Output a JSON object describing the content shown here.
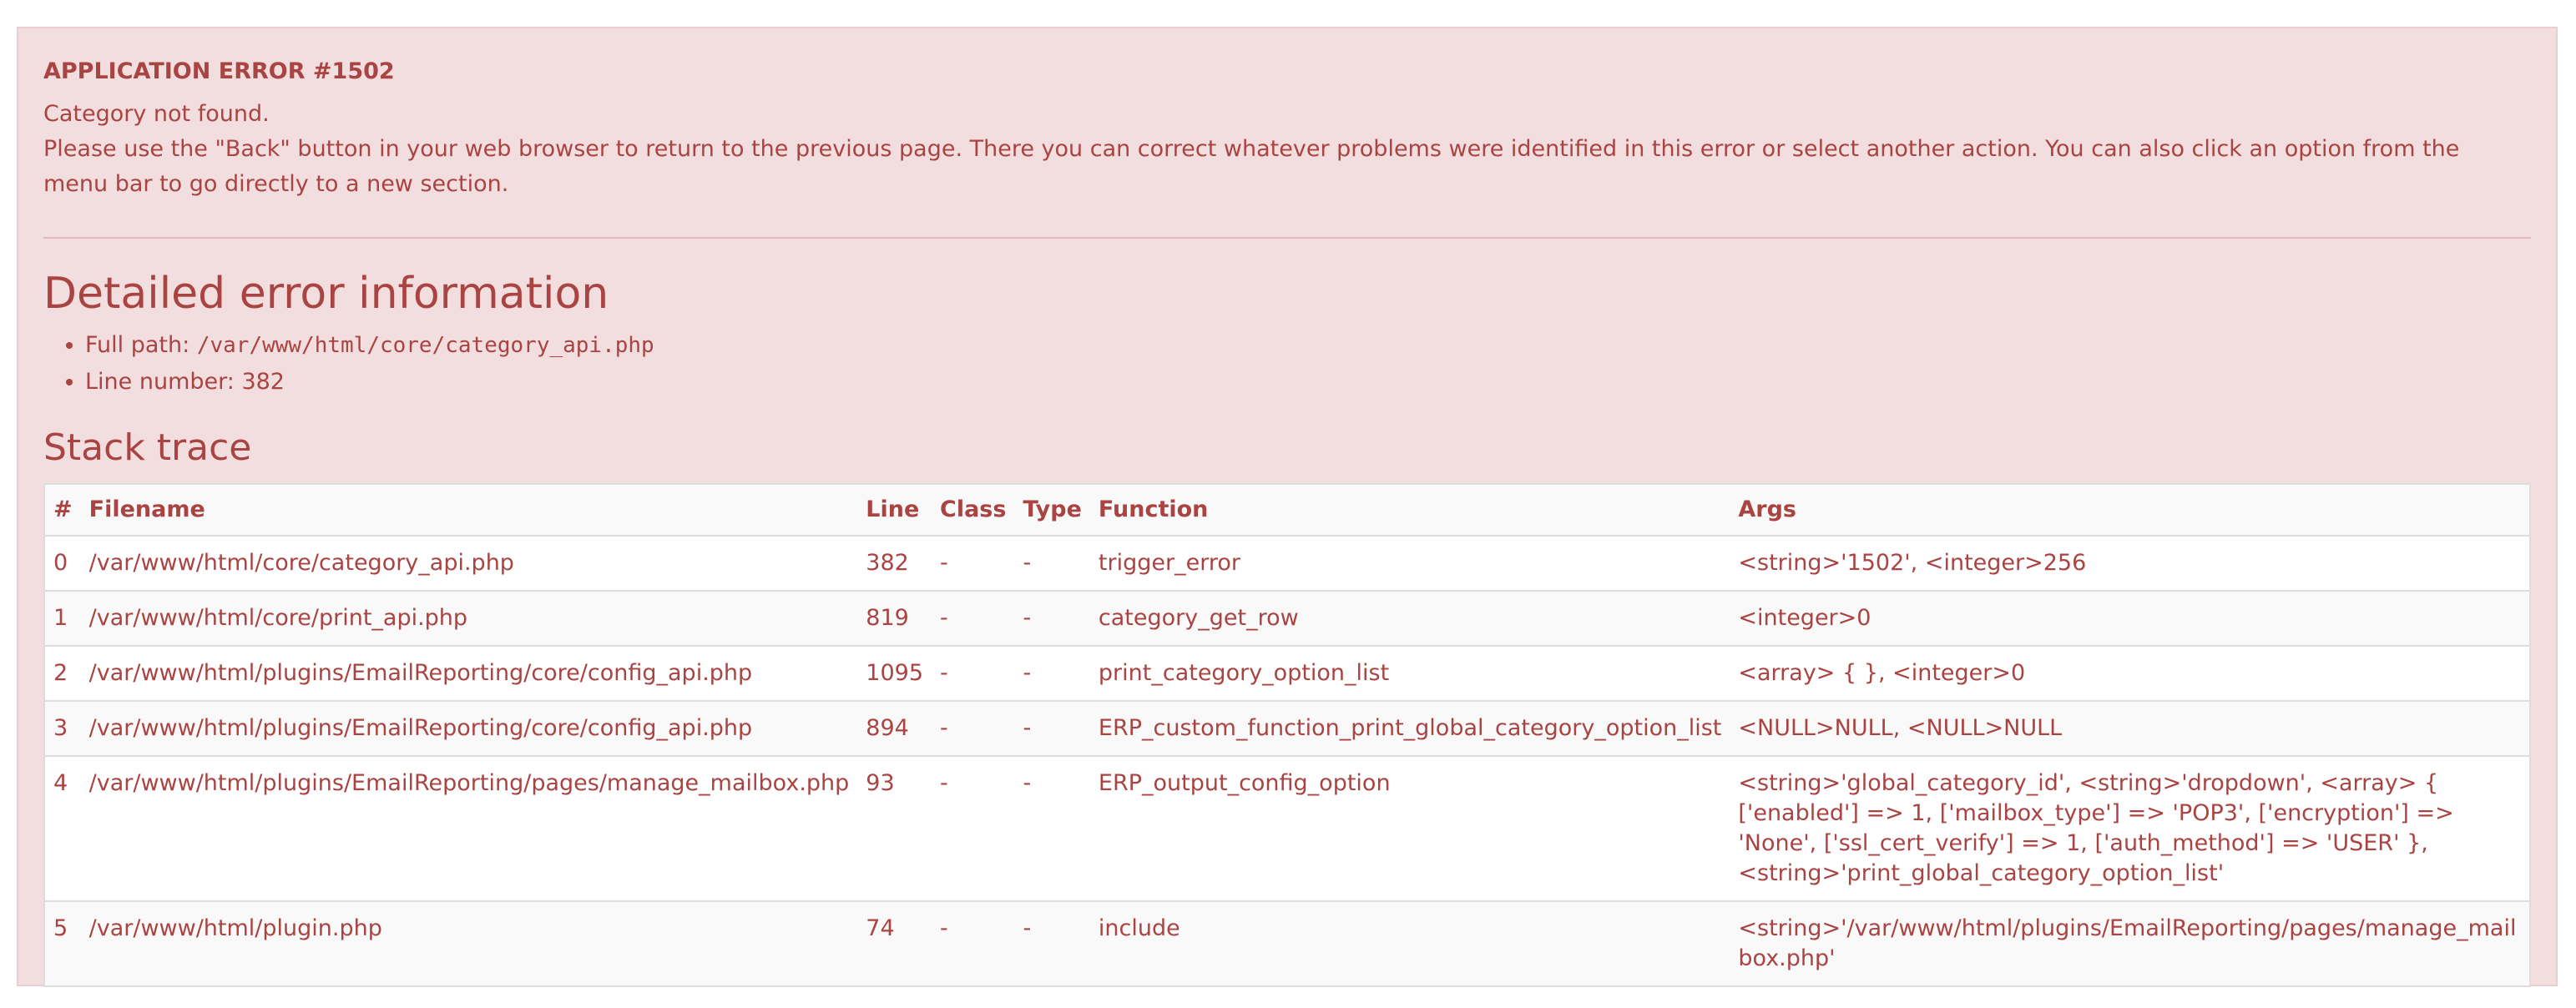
{
  "error": {
    "title": "APPLICATION ERROR #1502",
    "message_line1": "Category not found.",
    "message_line2": "Please use the \"Back\" button in your web browser to return to the previous page. There you can correct whatever problems were identified in this error or select another action. You can also click an option from the menu bar to go directly to a new section."
  },
  "details": {
    "heading": "Detailed error information",
    "full_path_label": "Full path: ",
    "full_path_value": "/var/www/html/core/category_api.php",
    "line_number_label": "Line number: ",
    "line_number_value": "382"
  },
  "stack": {
    "heading": "Stack trace",
    "columns": [
      "#",
      "Filename",
      "Line",
      "Class",
      "Type",
      "Function",
      "Args"
    ],
    "rows": [
      {
        "num": "0",
        "filename": "/var/www/html/core/category_api.php",
        "line": "382",
        "class": "-",
        "type": "-",
        "function": "trigger_error",
        "args": "<string>'1502', <integer>256"
      },
      {
        "num": "1",
        "filename": "/var/www/html/core/print_api.php",
        "line": "819",
        "class": "-",
        "type": "-",
        "function": "category_get_row",
        "args": "<integer>0"
      },
      {
        "num": "2",
        "filename": "/var/www/html/plugins/EmailReporting/core/config_api.php",
        "line": "1095",
        "class": "-",
        "type": "-",
        "function": "print_category_option_list",
        "args": "<array> { }, <integer>0"
      },
      {
        "num": "3",
        "filename": "/var/www/html/plugins/EmailReporting/core/config_api.php",
        "line": "894",
        "class": "-",
        "type": "-",
        "function": "ERP_custom_function_print_global_category_option_list",
        "args": "<NULL>NULL, <NULL>NULL"
      },
      {
        "num": "4",
        "filename": "/var/www/html/plugins/EmailReporting/pages/manage_mailbox.php",
        "line": "93",
        "class": "-",
        "type": "-",
        "function": "ERP_output_config_option",
        "args": "<string>'global_category_id', <string>'dropdown', <array> { ['enabled'] => 1, ['mailbox_type'] => 'POP3', ['encryption'] => 'None', ['ssl_cert_verify'] => 1, ['auth_method'] => 'USER' }, <string>'print_global_category_option_list'"
      },
      {
        "num": "5",
        "filename": "/var/www/html/plugin.php",
        "line": "74",
        "class": "-",
        "type": "-",
        "function": "include",
        "args": "<string>'/var/www/html/plugins/EmailReporting/pages/manage_mailbox.php'"
      }
    ]
  },
  "colors": {
    "alert_bg": "#f2dede",
    "alert_text": "#a94442",
    "alert_border": "#ebccd1"
  }
}
